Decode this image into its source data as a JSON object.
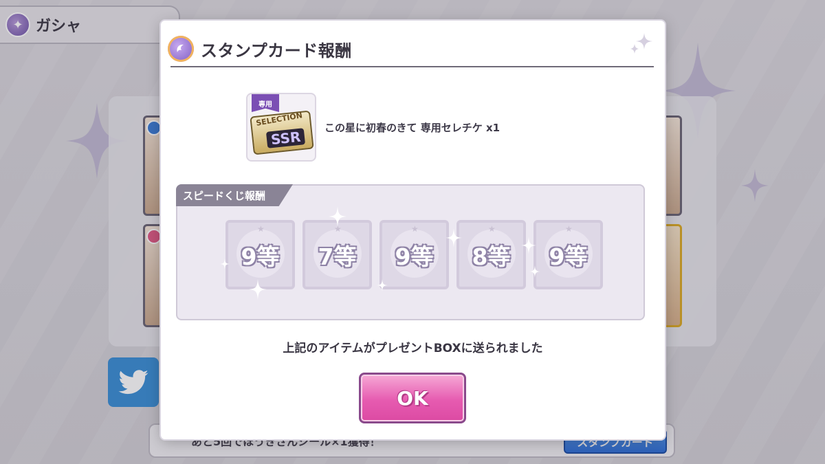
{
  "background": {
    "header_title": "ガシャ",
    "bottom_text": "あと5回でほうきさんシール×1獲得！",
    "bottom_button": "スタンプカード"
  },
  "dialog": {
    "title": "スタンプカード報酬",
    "reward": {
      "ticket_tag": "専用",
      "ticket_selection": "SELECTION",
      "ticket_rank": "SSR",
      "text": "この星に初春のきて 専用セレチケ x1"
    },
    "speed_section": {
      "label": "スピードくじ報酬",
      "prizes": [
        "9等",
        "7等",
        "9等",
        "8等",
        "9等"
      ]
    },
    "notice": "上記のアイテムがプレゼントBOXに送られました",
    "ok_label": "OK"
  },
  "colors": {
    "accent_pink": "#e65bb0",
    "header_rule": "#6f6a78",
    "section_label": "#8a8496"
  }
}
